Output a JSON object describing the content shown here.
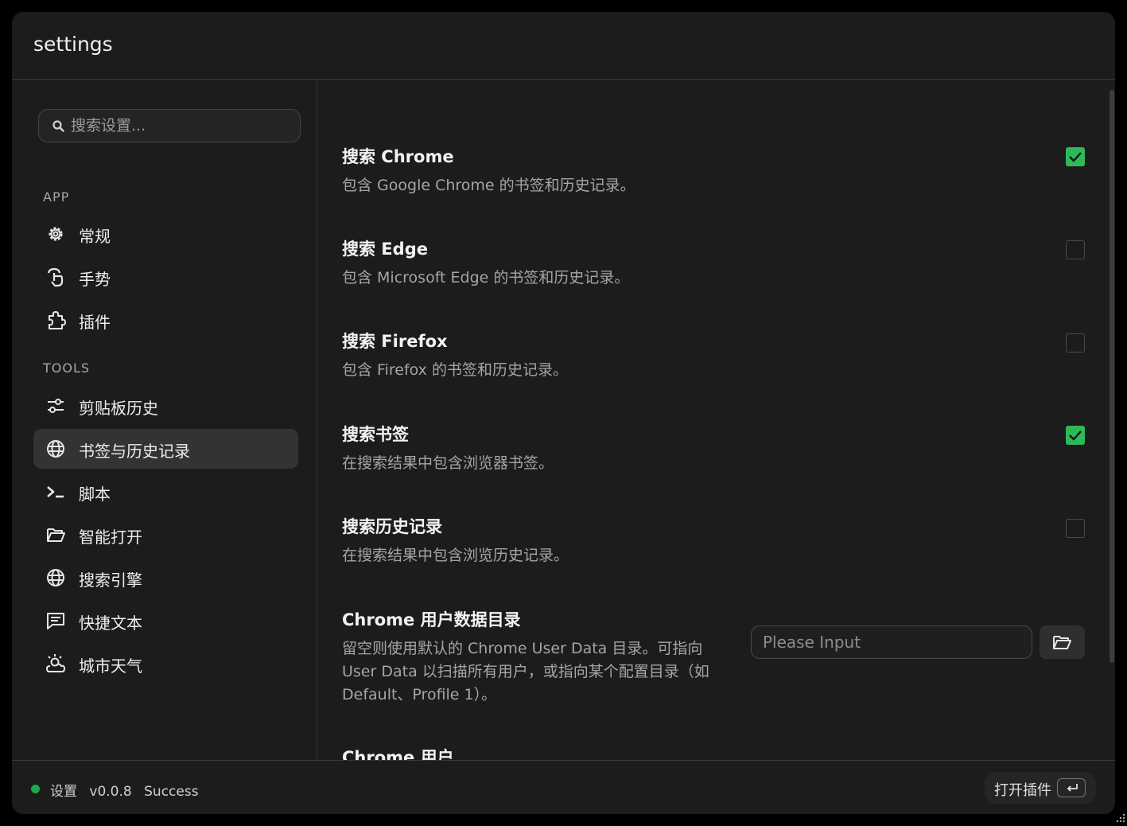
{
  "window": {
    "title": "settings"
  },
  "sidebar": {
    "search_placeholder": "搜索设置...",
    "sections": [
      {
        "title": "APP",
        "items": [
          {
            "label": "常规",
            "icon": "gear-icon"
          },
          {
            "label": "手势",
            "icon": "gesture-icon"
          },
          {
            "label": "插件",
            "icon": "puzzle-icon"
          }
        ]
      },
      {
        "title": "TOOLS",
        "items": [
          {
            "label": "剪贴板历史",
            "icon": "sliders-icon"
          },
          {
            "label": "书签与历史记录",
            "icon": "globe-icon",
            "active": true
          },
          {
            "label": "脚本",
            "icon": "terminal-icon"
          },
          {
            "label": "智能打开",
            "icon": "folder-icon"
          },
          {
            "label": "搜索引擎",
            "icon": "globe-icon"
          },
          {
            "label": "快捷文本",
            "icon": "message-icon"
          },
          {
            "label": "城市天气",
            "icon": "weather-icon"
          }
        ]
      }
    ]
  },
  "settings": [
    {
      "name": "搜索 Chrome",
      "desc": "包含 Google Chrome 的书签和历史记录。",
      "checked": true
    },
    {
      "name": "搜索 Edge",
      "desc": "包含 Microsoft Edge 的书签和历史记录。",
      "checked": false
    },
    {
      "name": "搜索 Firefox",
      "desc": "包含 Firefox 的书签和历史记录。",
      "checked": false
    },
    {
      "name": "搜索书签",
      "desc": "在搜索结果中包含浏览器书签。",
      "checked": true
    },
    {
      "name": "搜索历史记录",
      "desc": "在搜索结果中包含浏览历史记录。",
      "checked": false
    }
  ],
  "chrome_user_data": {
    "name": "Chrome 用户数据目录",
    "desc_lines": [
      "留空则使用默认的 Chrome User Data 目录。可指向",
      "User Data 以扫描所有用户，或指向某个配置目录（如",
      "Default、Profile 1）。"
    ],
    "placeholder": "Please Input",
    "value": ""
  },
  "chrome_user": {
    "name": "Chrome 用户"
  },
  "statusbar": {
    "app_name": "设置",
    "version": "v0.0.8",
    "status": "Success",
    "status_color": "#1ea84a",
    "open_plugin_label": "打开插件",
    "enter_key_icon": "enter-key-icon"
  },
  "colors": {
    "accent_check": "#2fb85a",
    "active_item_bg": "#333333"
  }
}
